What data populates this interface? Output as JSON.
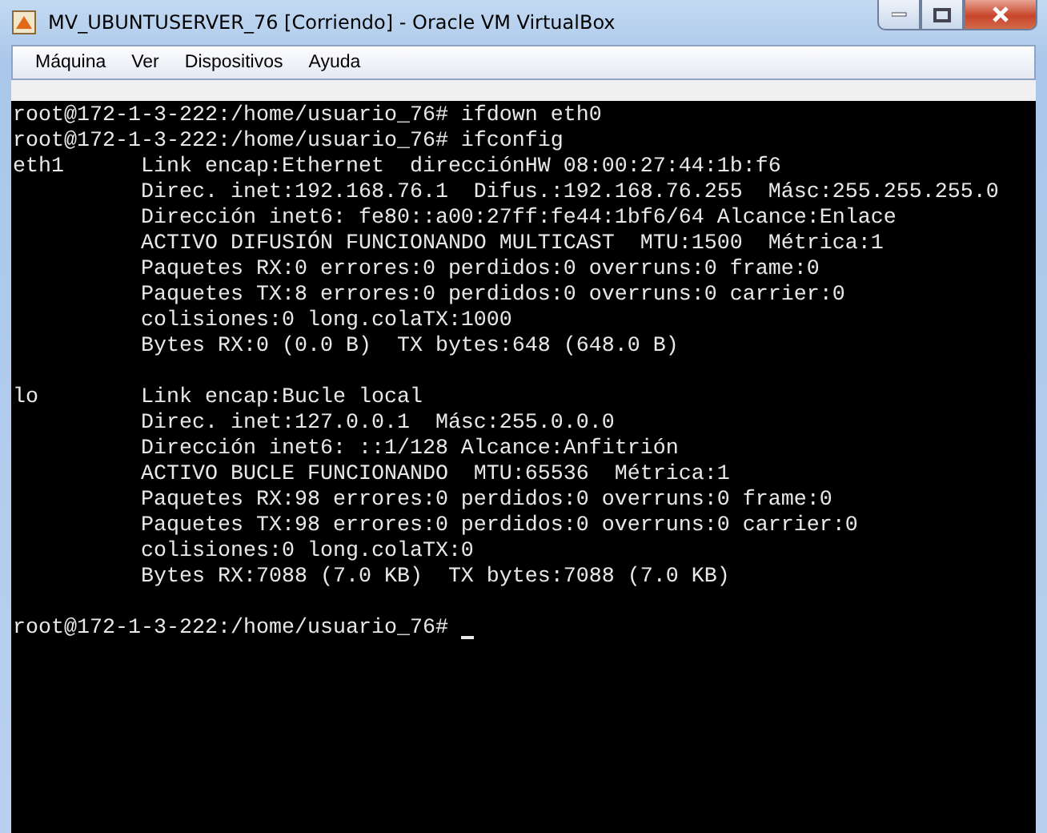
{
  "window": {
    "title": "MV_UBUNTUSERVER_76 [Corriendo] - Oracle VM VirtualBox"
  },
  "menu": [
    "Máquina",
    "Ver",
    "Dispositivos",
    "Ayuda"
  ],
  "terminal": {
    "blocks": [
      [
        "root@172-1-3-222:/home/usuario_76# ifdown eth0",
        "root@172-1-3-222:/home/usuario_76# ifconfig",
        "eth1      Link encap:Ethernet  direcciónHW 08:00:27:44:1b:f6",
        "          Direc. inet:192.168.76.1  Difus.:192.168.76.255  Másc:255.255.255.0",
        "          Dirección inet6: fe80::a00:27ff:fe44:1bf6/64 Alcance:Enlace",
        "          ACTIVO DIFUSIÓN FUNCIONANDO MULTICAST  MTU:1500  Métrica:1",
        "          Paquetes RX:0 errores:0 perdidos:0 overruns:0 frame:0",
        "          Paquetes TX:8 errores:0 perdidos:0 overruns:0 carrier:0",
        "          colisiones:0 long.colaTX:1000",
        "          Bytes RX:0 (0.0 B)  TX bytes:648 (648.0 B)"
      ],
      [
        "lo        Link encap:Bucle local",
        "          Direc. inet:127.0.0.1  Másc:255.0.0.0",
        "          Dirección inet6: ::1/128 Alcance:Anfitrión",
        "          ACTIVO BUCLE FUNCIONANDO  MTU:65536  Métrica:1",
        "          Paquetes RX:98 errores:0 perdidos:0 overruns:0 frame:0",
        "          Paquetes TX:98 errores:0 perdidos:0 overruns:0 carrier:0",
        "          colisiones:0 long.colaTX:0",
        "          Bytes RX:7088 (7.0 KB)  TX bytes:7088 (7.0 KB)"
      ]
    ],
    "prompt": "root@172-1-3-222:/home/usuario_76#"
  }
}
